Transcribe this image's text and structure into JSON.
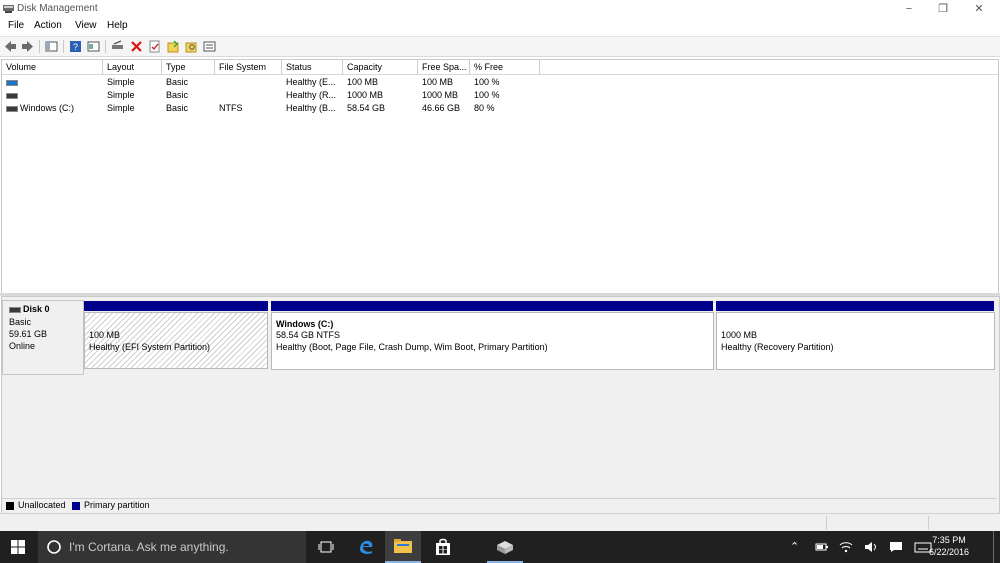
{
  "window": {
    "title": "Disk Management",
    "minimize": "−",
    "maximize": "❐",
    "close": "✕"
  },
  "menu": [
    "File",
    "Action",
    "View",
    "Help"
  ],
  "columns": [
    "Volume",
    "Layout",
    "Type",
    "File System",
    "Status",
    "Capacity",
    "Free Spa...",
    "% Free"
  ],
  "volumes": [
    {
      "volume": "",
      "layout": "Simple",
      "type": "Basic",
      "fs": "",
      "status": "Healthy (E...",
      "capacity": "100 MB",
      "free": "100 MB",
      "pct": "100 %"
    },
    {
      "volume": "",
      "layout": "Simple",
      "type": "Basic",
      "fs": "",
      "status": "Healthy (R...",
      "capacity": "1000 MB",
      "free": "1000 MB",
      "pct": "100 %"
    },
    {
      "volume": "Windows (C:)",
      "layout": "Simple",
      "type": "Basic",
      "fs": "NTFS",
      "status": "Healthy (B...",
      "capacity": "58.54 GB",
      "free": "46.66 GB",
      "pct": "80 %"
    }
  ],
  "disk": {
    "name": "Disk 0",
    "kind": "Basic",
    "size": "59.61 GB",
    "state": "Online"
  },
  "partitions": [
    {
      "title": "",
      "line1": "100 MB",
      "line2": "Healthy (EFI System Partition)"
    },
    {
      "title": "Windows  (C:)",
      "line1": "58.54 GB NTFS",
      "line2": "Healthy (Boot, Page File, Crash Dump, Wim Boot, Primary Partition)"
    },
    {
      "title": "",
      "line1": "1000 MB",
      "line2": "Healthy (Recovery Partition)"
    }
  ],
  "legend": [
    {
      "label": "Unallocated",
      "color": "#000000"
    },
    {
      "label": "Primary partition",
      "color": "#00008b"
    }
  ],
  "taskbar": {
    "search_placeholder": "I'm Cortana. Ask me anything.",
    "time": "7:35 PM",
    "date": "6/22/2016"
  },
  "colors": {
    "partition_bar": "#00008b",
    "taskbar": "#202020",
    "accent": "#1e74c8"
  }
}
